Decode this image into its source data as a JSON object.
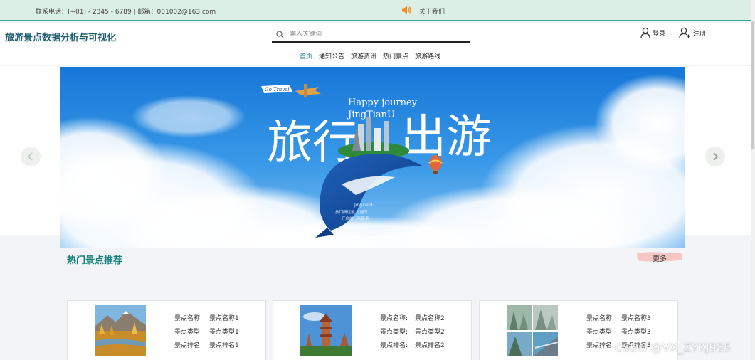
{
  "topbar": {
    "contact": "联系电话：(+01) - 2345 - 6789 | 邮箱：001002@163.com",
    "about": "关于我们",
    "colors": {
      "background": "#dcefe4",
      "accent": "#f08a1c",
      "line": "#3fa7a0"
    }
  },
  "header": {
    "brand": "旅游景点数据分析与可视化",
    "search_placeholder": "输入关键词",
    "login": "登录",
    "register": "注册"
  },
  "nav": [
    {
      "label": "首页",
      "active": true
    },
    {
      "label": "通知公告",
      "active": false
    },
    {
      "label": "旅游资讯",
      "active": false
    },
    {
      "label": "热门景点",
      "active": false
    },
    {
      "label": "旅游路线",
      "active": false
    }
  ],
  "banner": {
    "tag": "Go Travel",
    "headline_left": "旅行",
    "headline_right": "出游",
    "subtitle_1": "Happy journey",
    "subtitle_2": "JingTianU",
    "small_brand": "JingTianU",
    "small_line_1": "旅门所远游 方便无",
    "small_line_2": "开启旅行新篇章",
    "slide_count": 3,
    "active_slide": 3
  },
  "section": {
    "title": "热门景点推荐",
    "more": "更多"
  },
  "cards": [
    {
      "name_label": "景点名称:",
      "name": "景点名称1",
      "type_label": "景点类型:",
      "type": "景点类型1",
      "rank_label": "景点排名:",
      "rank": "景点排名1",
      "image": "autumn-lake-photo"
    },
    {
      "name_label": "景点名称:",
      "name": "景点名称2",
      "type_label": "景点类型:",
      "type": "景点类型2",
      "rank_label": "景点排名:",
      "rank": "景点排名2",
      "image": "pagoda-photo"
    },
    {
      "name_label": "景点名称:",
      "name": "景点名称3",
      "type_label": "景点类型:",
      "type": "景点类型3",
      "rank_label": "景点排名:",
      "rank": "景点排名3",
      "image": "mountain-collage-photo"
    }
  ],
  "watermark": "CSDN @VX_ZYKJ985",
  "icons": [
    "speaker-icon",
    "search-icon",
    "user-icon",
    "user-add-icon",
    "chevron-left-icon",
    "chevron-right-icon"
  ]
}
